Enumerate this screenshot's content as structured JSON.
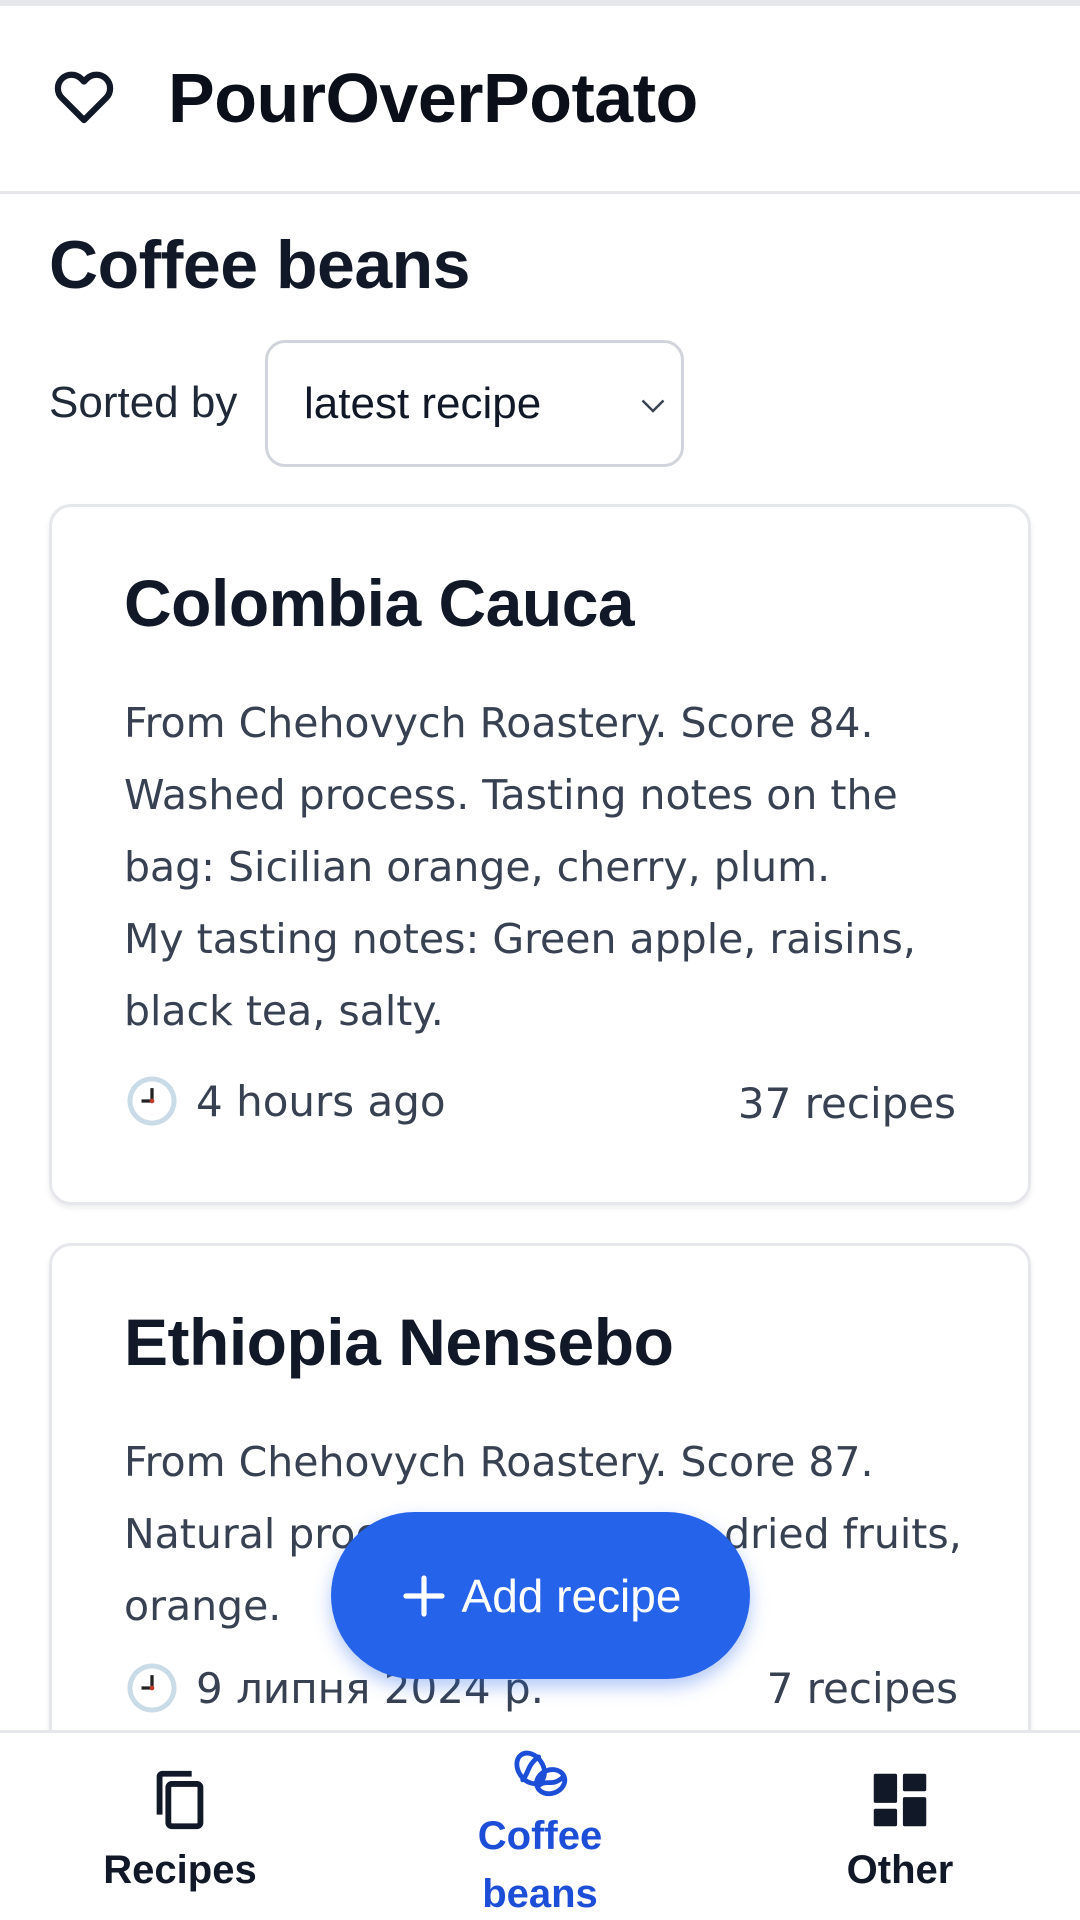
{
  "app": {
    "title": "PourOverPotato"
  },
  "page": {
    "title": "Coffee beans",
    "sort_label": "Sorted by",
    "sort_value": "latest recipe"
  },
  "beans": [
    {
      "name": "Colombia Cauca",
      "description_lines": [
        "From Chehovych Roastery. Score 84. Washed process. Tasting notes on the bag: Sicilian orange, cherry, plum.",
        "My tasting notes: Green apple, raisins, black tea, salty."
      ],
      "last_recipe": "4 hours ago",
      "recipe_count": "37 recipes"
    },
    {
      "name": "Ethiopia Nensebo",
      "description_lines": [
        "From Chehovych Roastery. Score 87. Natural process. Strawberry, dried fruits, orange."
      ],
      "last_recipe": "9 липня 2024 р.",
      "recipe_count": "7 recipes"
    }
  ],
  "fab": {
    "label": "Add recipe",
    "icon": "plus-icon"
  },
  "nav": [
    {
      "label": "Recipes",
      "icon": "copy-icon",
      "active": false
    },
    {
      "label": "Coffee beans",
      "icon": "coffee-beans-icon",
      "active": true
    },
    {
      "label": "Other",
      "icon": "dashboard-icon",
      "active": false
    }
  ],
  "colors": {
    "accent": "#2563eb",
    "active_nav": "#1d4ed8",
    "text": "#111827",
    "muted": "#374151",
    "border": "#e5e7eb"
  }
}
